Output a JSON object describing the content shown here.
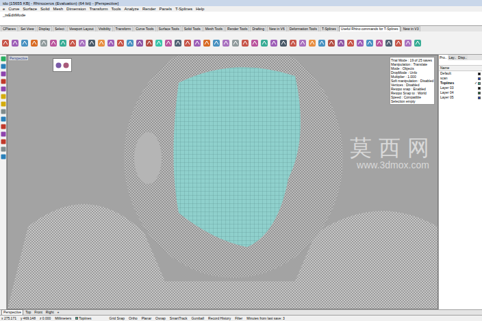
{
  "window": {
    "title": "ido [15655 KB] - Rhinoceros (Evaluation) (64 bit) - [Perspective]"
  },
  "menu": [
    "e",
    "Curve",
    "Surface",
    "Solid",
    "Mesh",
    "Dimension",
    "Transform",
    "Tools",
    "Analyze",
    "Render",
    "Panels",
    "T-Splines",
    "Help"
  ],
  "command": "_tsEditMode",
  "toolbar_tabs": [
    {
      "label": "CPlanes",
      "selected": false
    },
    {
      "label": "Set View",
      "selected": false
    },
    {
      "label": "Display",
      "selected": false
    },
    {
      "label": "Select",
      "selected": false
    },
    {
      "label": "Viewport Layout",
      "selected": false
    },
    {
      "label": "Visibility",
      "selected": false
    },
    {
      "label": "Transform",
      "selected": false
    },
    {
      "label": "Curve Tools",
      "selected": false
    },
    {
      "label": "Surface Tools",
      "selected": false
    },
    {
      "label": "Solid Tools",
      "selected": false
    },
    {
      "label": "Mesh Tools",
      "selected": false
    },
    {
      "label": "Render Tools",
      "selected": false
    },
    {
      "label": "Drafting",
      "selected": false
    },
    {
      "label": "New in V6",
      "selected": false
    },
    {
      "label": "Deformation Tools",
      "selected": false
    },
    {
      "label": "T-Splines",
      "selected": false
    },
    {
      "label": "Useful Rhino commands for T-Splines",
      "selected": true
    },
    {
      "label": "New in V3",
      "selected": false
    }
  ],
  "viewport": {
    "label": "Perspective",
    "info": [
      "Trial Mode : 19 of 25 saves",
      "Manipulation : Translate",
      "Mode : Objects",
      "DropMode : Unfo",
      "Multiplier : 1.000",
      "Soft manipulation : Disabled",
      "Vertices : Disabled",
      "Retopo snap : Enabled",
      "Retopo Snap to : World",
      "Speed : Compatible",
      "Selection empty"
    ],
    "watermark": [
      "莫西网",
      "www.3dmox.com"
    ]
  },
  "panel": {
    "tabs": [
      {
        "label": "Pro..",
        "selected": true
      },
      {
        "label": "Lay..",
        "selected": false
      },
      {
        "label": "Disp..",
        "selected": false
      }
    ],
    "column": "Name",
    "layers": [
      {
        "name": "Default",
        "current": false,
        "color": "#000000"
      },
      {
        "name": "scan",
        "current": false,
        "color": "#1f3fbf"
      },
      {
        "name": "Topiines",
        "current": true,
        "color": "#3fae8f"
      },
      {
        "name": "Layer 03",
        "current": false,
        "color": "#000000"
      },
      {
        "name": "Layer 04",
        "current": false,
        "color": "#1e6b2e"
      },
      {
        "name": "Layer 05",
        "current": false,
        "color": "#1f3fbf"
      }
    ]
  },
  "view_tabs": [
    {
      "label": "Perspective",
      "selected": true
    },
    {
      "label": "Top",
      "selected": false
    },
    {
      "label": "Front",
      "selected": false
    },
    {
      "label": "Right",
      "selected": false
    },
    {
      "label": "+",
      "selected": false
    }
  ],
  "status_bar": {
    "x": "x 275.171",
    "y": "y 469.148",
    "z": "z 0.000",
    "units": "Millimeters",
    "layer": "Topiines",
    "toggles": [
      {
        "label": "Grid Snap",
        "on": false
      },
      {
        "label": "Ortho",
        "on": false
      },
      {
        "label": "Planar",
        "on": false
      },
      {
        "label": "Osnap",
        "on": false
      },
      {
        "label": "SmartTrack",
        "on": false
      },
      {
        "label": "Gumball",
        "on": false
      },
      {
        "label": "Record History",
        "on": false
      },
      {
        "label": "Filter",
        "on": false
      }
    ],
    "message": "Minutes from last save: 3"
  }
}
